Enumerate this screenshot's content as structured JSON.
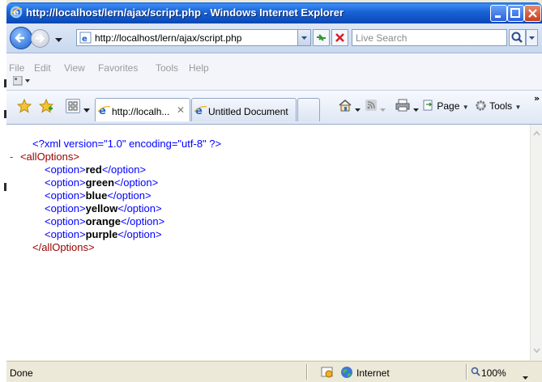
{
  "window": {
    "title": "http://localhost/lern/ajax/script.php - Windows Internet Explorer"
  },
  "navbar": {
    "address": "http://localhost/lern/ajax/script.php",
    "search_placeholder": "Live Search"
  },
  "menubar": {
    "items": [
      "File",
      "Edit",
      "View",
      "Favorites",
      "Tools",
      "Help"
    ]
  },
  "tabs": [
    {
      "label": "http://localh...",
      "active": true
    },
    {
      "label": "Untitled Document",
      "active": false
    }
  ],
  "commandbar": {
    "page_label": "Page",
    "tools_label": "Tools",
    "overflow": "»"
  },
  "xml": {
    "declaration": "<?xml version=\"1.0\" encoding=\"utf-8\" ?>",
    "collapse_marker": "-",
    "root_open": "<allOptions>",
    "root_close": "</allOptions>",
    "option_open": "<option>",
    "option_close": "</option>",
    "options": [
      "red",
      "green",
      "blue",
      "yellow",
      "orange",
      "purple"
    ]
  },
  "status": {
    "text": "Done",
    "zone": "Internet",
    "zoom": "100%"
  },
  "colors": {
    "title_bar": "#0d4fc0",
    "xml_markup": "#0000ff",
    "xml_tag": "#990000",
    "collapse_marker": "#ff0000"
  }
}
